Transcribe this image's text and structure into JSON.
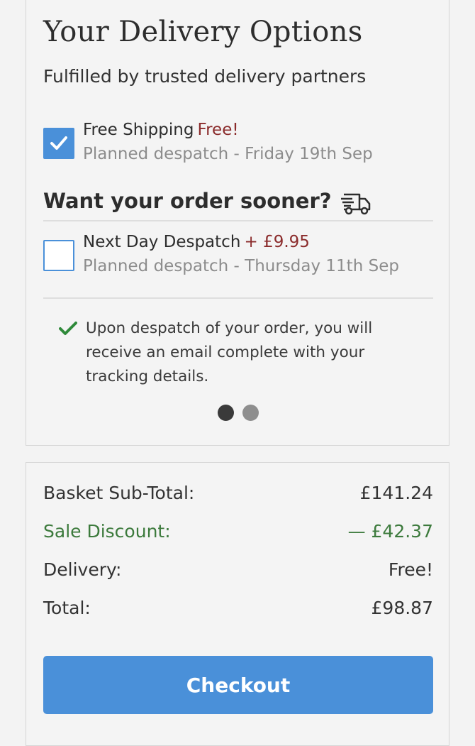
{
  "delivery": {
    "title": "Your Delivery Options",
    "subtitle": "Fulfilled by trusted delivery partners",
    "options": [
      {
        "name": "Free Shipping",
        "price": "Free!",
        "despatch": "Planned despatch - Friday 19th Sep",
        "checked": true
      },
      {
        "name": "Next Day Despatch",
        "price": "+ £9.95",
        "despatch": "Planned despatch - Thursday 11th Sep",
        "checked": false
      }
    ],
    "sooner_heading": "Want your order sooner?",
    "info": "Upon despatch of your order, you will receive an email complete with your tracking details.",
    "carousel": {
      "pages": 2,
      "active": 1
    }
  },
  "summary": {
    "subtotal_label": "Basket Sub-Total:",
    "subtotal_value": "£141.24",
    "discount_label": "Sale Discount:",
    "discount_value": "— £42.37",
    "delivery_label": "Delivery:",
    "delivery_value": "Free!",
    "total_label": "Total:",
    "total_value": "£98.87",
    "checkout_label": "Checkout"
  },
  "colors": {
    "accent": "#4a90d9",
    "price": "#8b2c2c",
    "discount": "#3c7a3c",
    "check_green": "#2f8a3a"
  },
  "icons": {
    "checkbox_check": "check-icon",
    "truck": "delivery-truck-icon",
    "info_check": "tick-icon"
  }
}
